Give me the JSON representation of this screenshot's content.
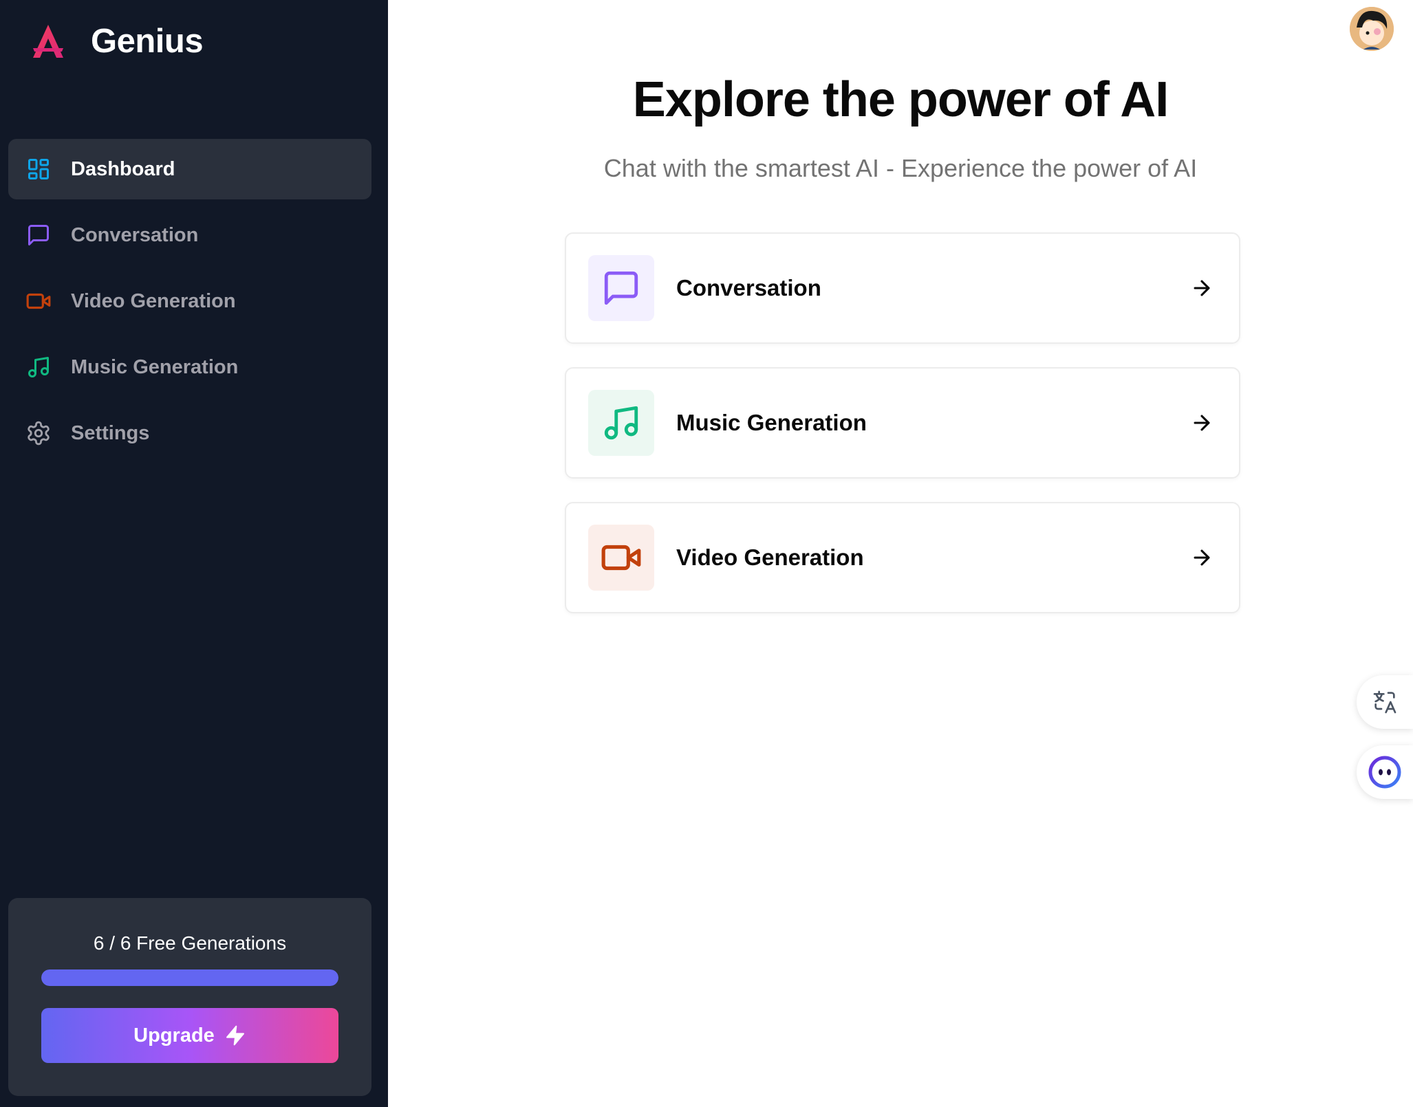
{
  "app": {
    "name": "Genius",
    "accent": "#ec4899"
  },
  "sidebar": {
    "items": [
      {
        "label": "Dashboard",
        "icon": "layout-dashboard-icon",
        "color": "#0ea5e9",
        "active": true
      },
      {
        "label": "Conversation",
        "icon": "message-square-icon",
        "color": "#8b5cf6",
        "active": false
      },
      {
        "label": "Video Generation",
        "icon": "video-icon",
        "color": "#c2410c",
        "active": false
      },
      {
        "label": "Music Generation",
        "icon": "music-icon",
        "color": "#10b981",
        "active": false
      },
      {
        "label": "Settings",
        "icon": "settings-icon",
        "color": "#a1a1aa",
        "active": false
      }
    ],
    "credits": {
      "text": "6 / 6 Free Generations",
      "used": 6,
      "limit": 6,
      "upgrade_label": "Upgrade",
      "upgrade_icon": "zap-icon"
    }
  },
  "main": {
    "title": "Explore the power of AI",
    "subtitle": "Chat with the smartest AI - Experience the power of AI",
    "tools": [
      {
        "label": "Conversation",
        "icon": "message-square-icon",
        "color": "#8b5cf6",
        "bg": "#f3f0ff"
      },
      {
        "label": "Music Generation",
        "icon": "music-icon",
        "color": "#10b981",
        "bg": "#ecf8f2"
      },
      {
        "label": "Video Generation",
        "icon": "video-icon",
        "color": "#c2410c",
        "bg": "#fbeeea"
      }
    ]
  },
  "floating": {
    "translate_icon": "translate-icon",
    "assistant_icon": "assistant-face-icon"
  },
  "user": {
    "avatar_icon": "user-avatar"
  }
}
